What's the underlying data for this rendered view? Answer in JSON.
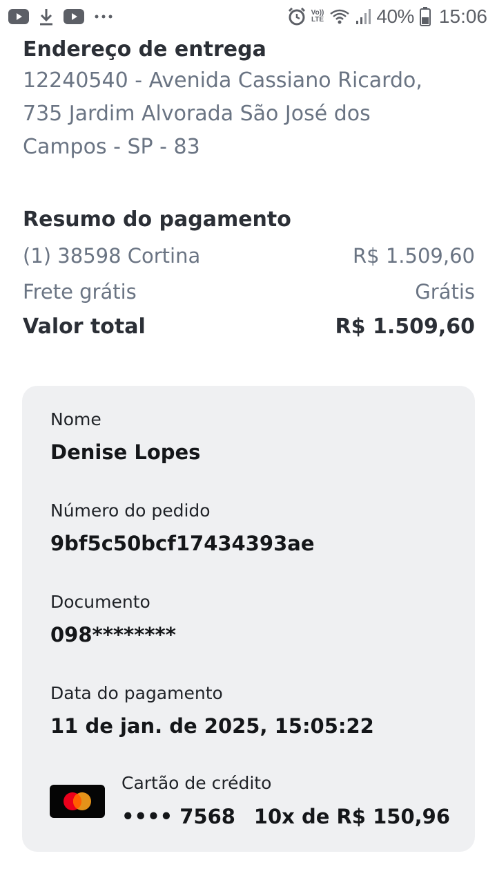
{
  "status_bar": {
    "battery": "40%",
    "time": "15:06",
    "lte_label_top": "Vo))",
    "lte_label_bottom": "LTE"
  },
  "address": {
    "title": "Endereço de entrega",
    "lines": [
      "12240540 - Avenida Cassiano Ricardo,",
      "735 Jardim Alvorada São José dos",
      "Campos - SP - 83"
    ]
  },
  "summary": {
    "title": "Resumo do pagamento",
    "item_label": "(1) 38598 Cortina",
    "item_value": "R$ 1.509,60",
    "shipping_label": "Frete grátis",
    "shipping_value": "Grátis",
    "total_label": "Valor total",
    "total_value": "R$ 1.509,60"
  },
  "details": {
    "name_label": "Nome",
    "name_value": "Denise Lopes",
    "order_label": "Número do pedido",
    "order_value": "9bf5c50bcf17434393ae",
    "document_label": "Documento",
    "document_value": "098********",
    "date_label": "Data do pagamento",
    "date_value": "11 de jan. de 2025, 15:05:22"
  },
  "payment": {
    "method_label": "Cartão de crédito",
    "card_number": "•••• 7568",
    "installments": "10x de R$ 150,96",
    "brand_icon": "mastercard-logo"
  },
  "colors": {
    "card_bg": "#eff0f2",
    "muted_text": "#6a7483",
    "mastercard_red": "#eb001b",
    "mastercard_orange": "#f79e1b"
  }
}
